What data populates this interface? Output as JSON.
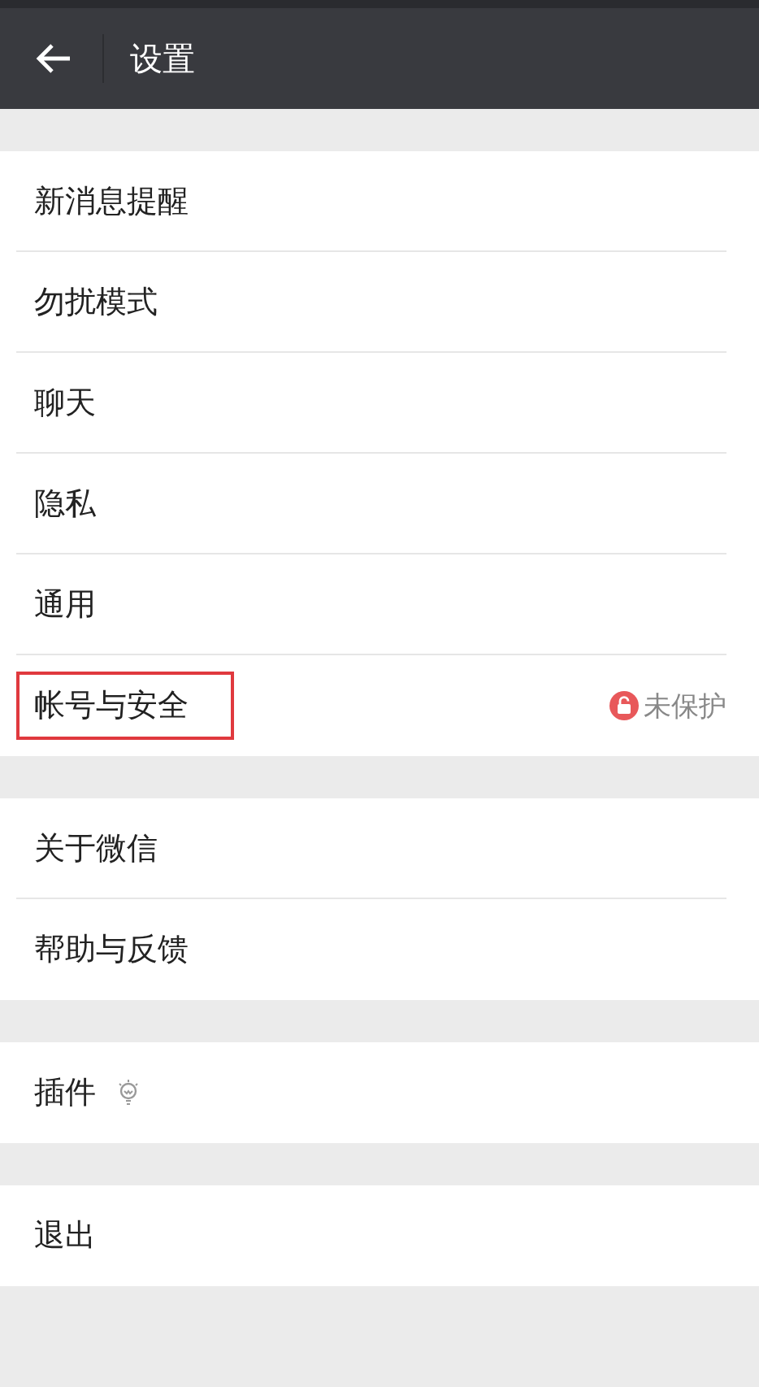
{
  "header": {
    "title": "设置"
  },
  "groups": [
    {
      "items": [
        {
          "kind": "plain",
          "label": "新消息提醒",
          "highlighted": false
        },
        {
          "kind": "plain",
          "label": "勿扰模式",
          "highlighted": false
        },
        {
          "kind": "plain",
          "label": "聊天",
          "highlighted": false
        },
        {
          "kind": "plain",
          "label": "隐私",
          "highlighted": false
        },
        {
          "kind": "plain",
          "label": "通用",
          "highlighted": false
        },
        {
          "kind": "status",
          "label": "帐号与安全",
          "highlighted": true,
          "status": "未保护"
        }
      ]
    },
    {
      "items": [
        {
          "kind": "plain",
          "label": "关于微信",
          "highlighted": false
        },
        {
          "kind": "plain",
          "label": "帮助与反馈",
          "highlighted": false
        }
      ]
    },
    {
      "items": [
        {
          "kind": "bulb",
          "label": "插件",
          "highlighted": false
        }
      ]
    },
    {
      "items": [
        {
          "kind": "plain",
          "label": "退出",
          "highlighted": false
        }
      ]
    }
  ]
}
